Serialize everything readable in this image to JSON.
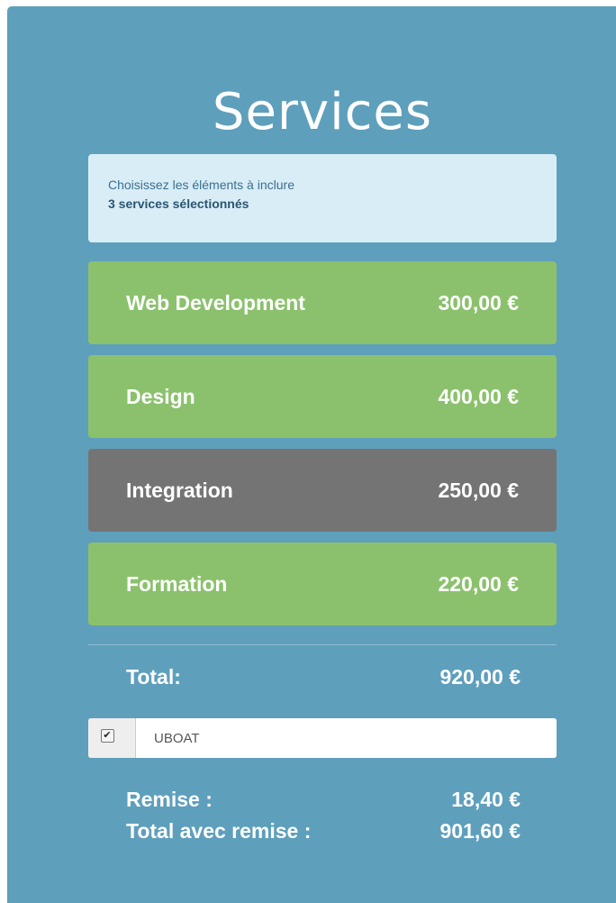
{
  "header": {
    "title": "Services"
  },
  "info": {
    "line1": "Choisissez les éléments à inclure",
    "line2": "3 services sélectionnés"
  },
  "services": [
    {
      "name": "Web Development",
      "price": "300,00 €",
      "selected": true
    },
    {
      "name": "Design",
      "price": "400,00 €",
      "selected": true
    },
    {
      "name": "Integration",
      "price": "250,00 €",
      "selected": false
    },
    {
      "name": "Formation",
      "price": "220,00 €",
      "selected": true
    }
  ],
  "total": {
    "label": "Total:",
    "value": "920,00 €"
  },
  "coupon": {
    "checked": true,
    "value": "UBOAT"
  },
  "discount": {
    "label": "Remise :",
    "value": "18,40 €"
  },
  "total_discounted": {
    "label": "Total avec remise :",
    "value": "901,60 €"
  },
  "colors": {
    "panel": "#5e9fbc",
    "selected": "#8bc16c",
    "unselected": "#747474",
    "info_bg": "#d9edf7"
  }
}
